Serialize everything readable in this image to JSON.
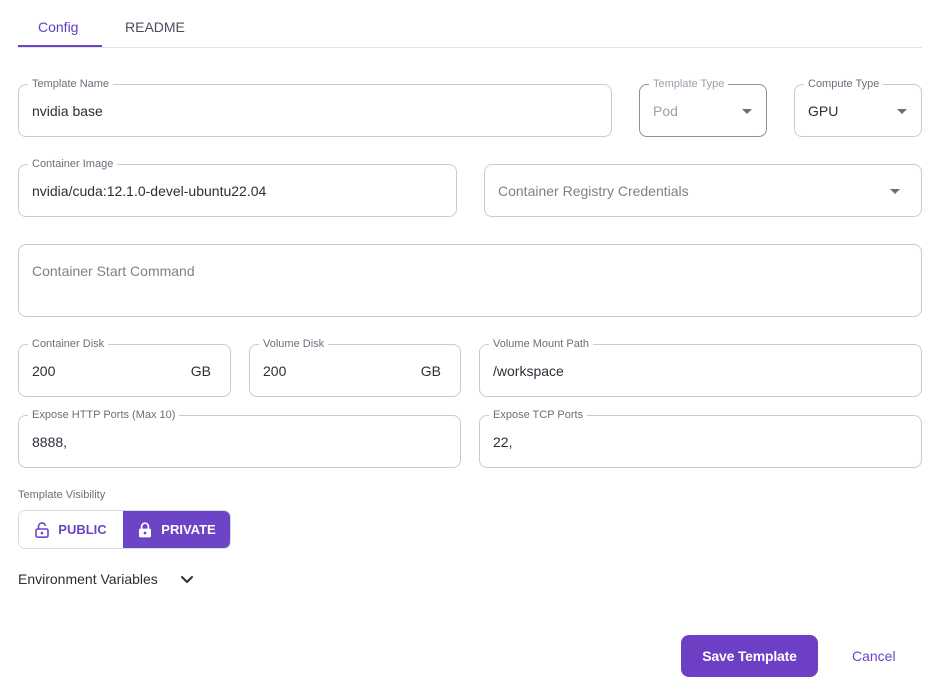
{
  "tabs": [
    {
      "label": "Config",
      "active": true
    },
    {
      "label": "README",
      "active": false
    }
  ],
  "fields": {
    "template_name": {
      "label": "Template Name",
      "value": "nvidia base"
    },
    "template_type": {
      "label": "Template Type",
      "value": "Pod"
    },
    "compute_type": {
      "label": "Compute Type",
      "value": "GPU"
    },
    "container_image": {
      "label": "Container Image",
      "value": "nvidia/cuda:12.1.0-devel-ubuntu22.04"
    },
    "registry_credentials": {
      "placeholder": "Container Registry Credentials"
    },
    "start_command": {
      "placeholder": "Container Start Command"
    },
    "container_disk": {
      "label": "Container Disk",
      "value": "200",
      "unit": "GB"
    },
    "volume_disk": {
      "label": "Volume Disk",
      "value": "200",
      "unit": "GB"
    },
    "volume_mount_path": {
      "label": "Volume Mount Path",
      "value": "/workspace"
    },
    "http_ports": {
      "label": "Expose HTTP Ports (Max 10)",
      "value": "8888,"
    },
    "tcp_ports": {
      "label": "Expose TCP Ports",
      "value": "22,"
    }
  },
  "visibility": {
    "label": "Template Visibility",
    "options": [
      {
        "label": "PUBLIC",
        "icon": "lock-open-icon",
        "selected": false
      },
      {
        "label": "PRIVATE",
        "icon": "lock-icon",
        "selected": true
      }
    ]
  },
  "env": {
    "label": "Environment Variables",
    "icon": "chevron-down-icon"
  },
  "actions": {
    "save": "Save Template",
    "cancel": "Cancel"
  },
  "colors": {
    "accent": "#6c45c7",
    "border": "#c9cbd3",
    "text": "#2b2f38",
    "muted": "#9ca0ab"
  }
}
